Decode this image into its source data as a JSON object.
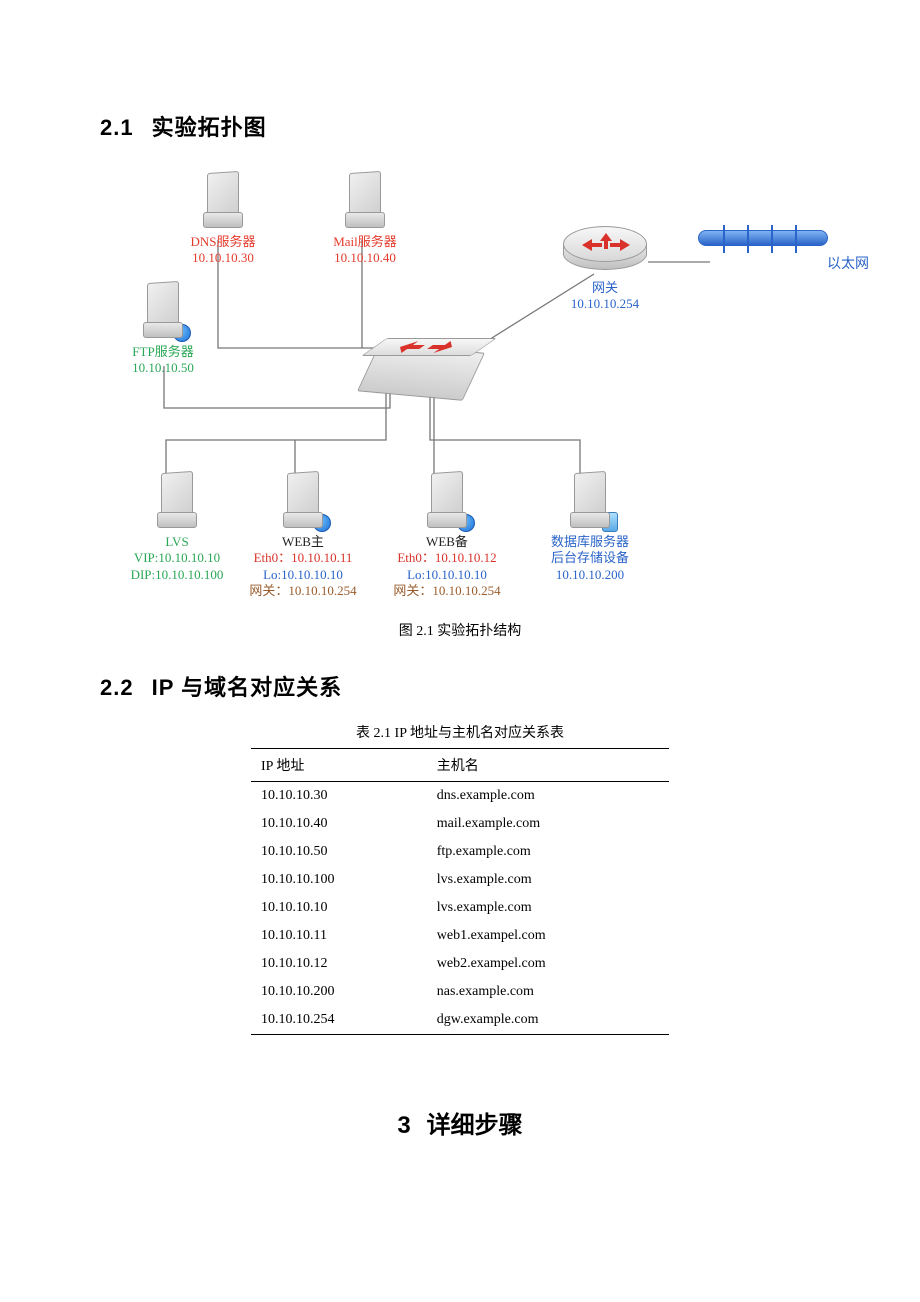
{
  "sections": {
    "s21": {
      "num": "2.1",
      "title": "实验拓扑图"
    },
    "s22": {
      "num": "2.2",
      "title": "IP 与域名对应关系"
    },
    "s3": {
      "num": "3",
      "title": "详细步骤"
    }
  },
  "diagram": {
    "caption": "图 2.1  实验拓扑结构",
    "ethernet_label": "以太网",
    "nodes": {
      "dns": {
        "name": "DNS服务器",
        "ip": "10.10.10.30"
      },
      "mail": {
        "name": "Mail服务器",
        "ip": "10.10.10.40"
      },
      "ftp": {
        "name": "FTP服务器",
        "ip": "10.10.10.50"
      },
      "gateway": {
        "name": "网关",
        "ip": "10.10.10.254"
      },
      "lvs": {
        "name": "LVS",
        "vip": "VIP:10.10.10.10",
        "dip": "DIP:10.10.10.100"
      },
      "web1": {
        "name": "WEB主",
        "eth0": "Eth0：10.10.10.11",
        "lo": "Lo:10.10.10.10",
        "gw": "网关：10.10.10.254"
      },
      "web2": {
        "name": "WEB备",
        "eth0": "Eth0：10.10.10.12",
        "lo": "Lo:10.10.10.10",
        "gw": "网关：10.10.10.254"
      },
      "db": {
        "name1": "数据库服务器",
        "name2": "后台存储设备",
        "ip": "10.10.10.200"
      }
    }
  },
  "table": {
    "title": "表 2.1  IP 地址与主机名对应关系表",
    "headers": {
      "ip": "IP 地址",
      "host": "主机名"
    },
    "rows": [
      {
        "ip": "10.10.10.30",
        "host": "dns.example.com"
      },
      {
        "ip": "10.10.10.40",
        "host": "mail.example.com"
      },
      {
        "ip": "10.10.10.50",
        "host": "ftp.example.com"
      },
      {
        "ip": "10.10.10.100",
        "host": "lvs.example.com"
      },
      {
        "ip": "10.10.10.10",
        "host": "lvs.example.com"
      },
      {
        "ip": "10.10.10.11",
        "host": "web1.exampel.com"
      },
      {
        "ip": "10.10.10.12",
        "host": "web2.exampel.com"
      },
      {
        "ip": "10.10.10.200",
        "host": "nas.example.com"
      },
      {
        "ip": "10.10.10.254",
        "host": "dgw.example.com"
      }
    ]
  }
}
